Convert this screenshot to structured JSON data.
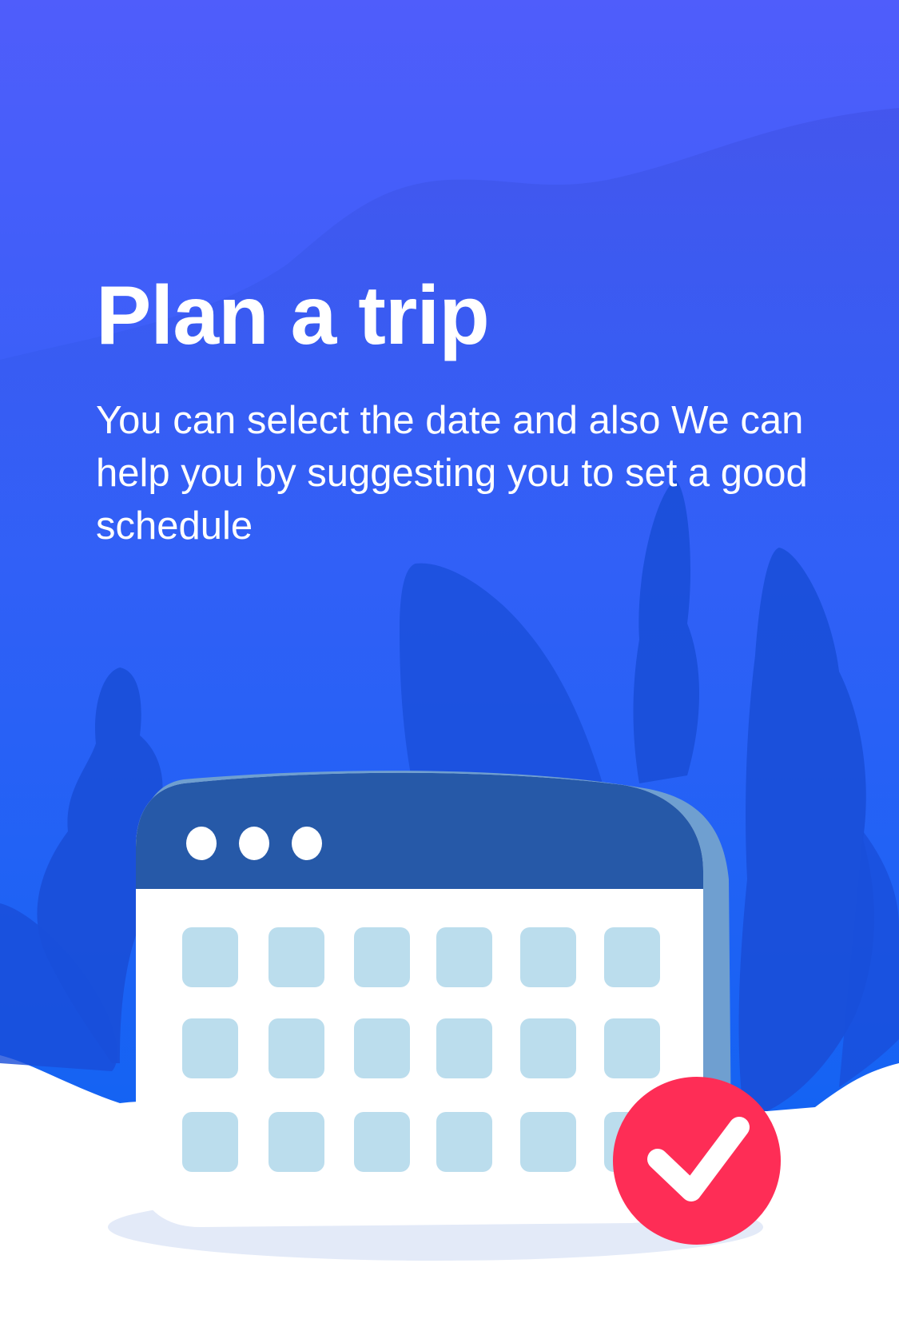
{
  "onboarding": {
    "title": "Plan a trip",
    "description": "You can select the date and also We can help you by suggesting you to set a good schedule"
  },
  "colors": {
    "background_top": "#4F5DFB",
    "background_bottom": "#0F63EE",
    "calendar_header": "#2659A8",
    "calendar_cell": "#BBDDED",
    "check_badge": "#FE2D56",
    "text": "#FFFFFF"
  },
  "icons": {
    "calendar": "calendar-icon",
    "check": "checkmark-icon"
  }
}
